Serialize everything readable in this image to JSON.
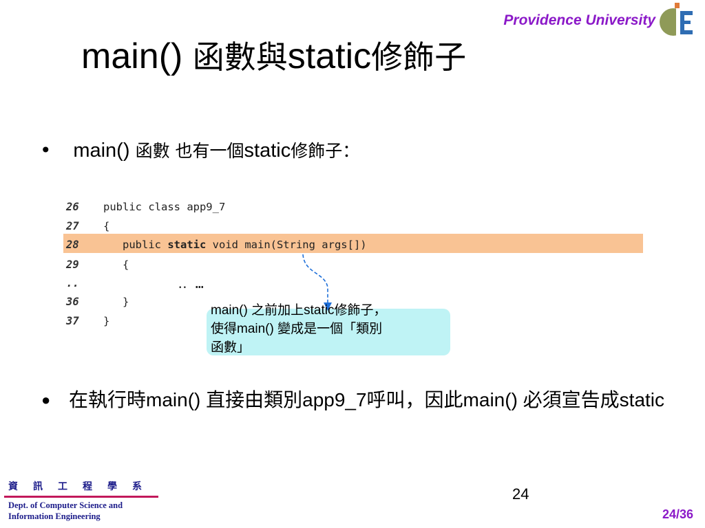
{
  "header": {
    "university": "Providence University",
    "logo_text": "E"
  },
  "title": {
    "latin_a": "main() ",
    "cjk_a": "函數與",
    "latin_b": "static",
    "cjk_b": "修飾子"
  },
  "bullets": {
    "first": {
      "marker": "•",
      "latin_a": "main() ",
      "cjk_a": "函數 也有一個",
      "latin_b": "static",
      "cjk_b": "修飾子："
    },
    "second": {
      "marker": "●",
      "text": "在執行時main() 直接由類別app9_7呼叫，因此main() 必須宣告成static"
    }
  },
  "code": {
    "lines": [
      {
        "no": "26",
        "text": "public class app9_7"
      },
      {
        "no": "27",
        "text": "{"
      },
      {
        "no": "28",
        "pre": "   public ",
        "bold": "static",
        "post": " void main(String args[])"
      },
      {
        "no": "29",
        "text": "   {"
      },
      {
        "no": "..",
        "text": "         ‥ …"
      },
      {
        "no": "36",
        "text": "   }"
      },
      {
        "no": "37",
        "text": "}"
      }
    ]
  },
  "callout": {
    "line1": "main()  之前加上static修飾子，",
    "line2": "使得main()  變成是一個「類別",
    "line3": "函數」",
    "colors": {
      "background": "#bff3f5",
      "arrow": "#1e6fd9"
    }
  },
  "highlight_color": "#f9c394",
  "footer": {
    "dept_cn": "資訊工程學系",
    "dept_en_1": "Dept. of Computer Science and",
    "dept_en_2": "Information Engineering",
    "page_number": "24",
    "page_of_total": "24/36"
  }
}
